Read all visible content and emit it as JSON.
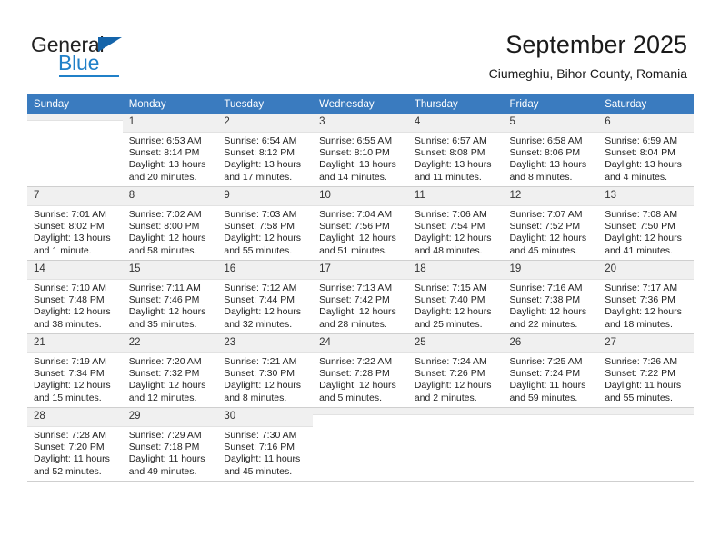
{
  "brand": {
    "name_top": "General",
    "name_bottom": "Blue",
    "accent_color": "#2080c8",
    "triangle_color": "#1464aa"
  },
  "header": {
    "month_title": "September 2025",
    "location": "Ciumeghiu, Bihor County, Romania"
  },
  "calendar": {
    "header_bg": "#3a7bbf",
    "weekdays": [
      "Sunday",
      "Monday",
      "Tuesday",
      "Wednesday",
      "Thursday",
      "Friday",
      "Saturday"
    ],
    "weeks": [
      [
        {
          "day": "",
          "empty": true,
          "sunrise": "",
          "sunset": "",
          "daylight": ""
        },
        {
          "day": "1",
          "sunrise": "Sunrise: 6:53 AM",
          "sunset": "Sunset: 8:14 PM",
          "daylight": "Daylight: 13 hours and 20 minutes."
        },
        {
          "day": "2",
          "sunrise": "Sunrise: 6:54 AM",
          "sunset": "Sunset: 8:12 PM",
          "daylight": "Daylight: 13 hours and 17 minutes."
        },
        {
          "day": "3",
          "sunrise": "Sunrise: 6:55 AM",
          "sunset": "Sunset: 8:10 PM",
          "daylight": "Daylight: 13 hours and 14 minutes."
        },
        {
          "day": "4",
          "sunrise": "Sunrise: 6:57 AM",
          "sunset": "Sunset: 8:08 PM",
          "daylight": "Daylight: 13 hours and 11 minutes."
        },
        {
          "day": "5",
          "sunrise": "Sunrise: 6:58 AM",
          "sunset": "Sunset: 8:06 PM",
          "daylight": "Daylight: 13 hours and 8 minutes."
        },
        {
          "day": "6",
          "sunrise": "Sunrise: 6:59 AM",
          "sunset": "Sunset: 8:04 PM",
          "daylight": "Daylight: 13 hours and 4 minutes."
        }
      ],
      [
        {
          "day": "7",
          "sunrise": "Sunrise: 7:01 AM",
          "sunset": "Sunset: 8:02 PM",
          "daylight": "Daylight: 13 hours and 1 minute."
        },
        {
          "day": "8",
          "sunrise": "Sunrise: 7:02 AM",
          "sunset": "Sunset: 8:00 PM",
          "daylight": "Daylight: 12 hours and 58 minutes."
        },
        {
          "day": "9",
          "sunrise": "Sunrise: 7:03 AM",
          "sunset": "Sunset: 7:58 PM",
          "daylight": "Daylight: 12 hours and 55 minutes."
        },
        {
          "day": "10",
          "sunrise": "Sunrise: 7:04 AM",
          "sunset": "Sunset: 7:56 PM",
          "daylight": "Daylight: 12 hours and 51 minutes."
        },
        {
          "day": "11",
          "sunrise": "Sunrise: 7:06 AM",
          "sunset": "Sunset: 7:54 PM",
          "daylight": "Daylight: 12 hours and 48 minutes."
        },
        {
          "day": "12",
          "sunrise": "Sunrise: 7:07 AM",
          "sunset": "Sunset: 7:52 PM",
          "daylight": "Daylight: 12 hours and 45 minutes."
        },
        {
          "day": "13",
          "sunrise": "Sunrise: 7:08 AM",
          "sunset": "Sunset: 7:50 PM",
          "daylight": "Daylight: 12 hours and 41 minutes."
        }
      ],
      [
        {
          "day": "14",
          "sunrise": "Sunrise: 7:10 AM",
          "sunset": "Sunset: 7:48 PM",
          "daylight": "Daylight: 12 hours and 38 minutes."
        },
        {
          "day": "15",
          "sunrise": "Sunrise: 7:11 AM",
          "sunset": "Sunset: 7:46 PM",
          "daylight": "Daylight: 12 hours and 35 minutes."
        },
        {
          "day": "16",
          "sunrise": "Sunrise: 7:12 AM",
          "sunset": "Sunset: 7:44 PM",
          "daylight": "Daylight: 12 hours and 32 minutes."
        },
        {
          "day": "17",
          "sunrise": "Sunrise: 7:13 AM",
          "sunset": "Sunset: 7:42 PM",
          "daylight": "Daylight: 12 hours and 28 minutes."
        },
        {
          "day": "18",
          "sunrise": "Sunrise: 7:15 AM",
          "sunset": "Sunset: 7:40 PM",
          "daylight": "Daylight: 12 hours and 25 minutes."
        },
        {
          "day": "19",
          "sunrise": "Sunrise: 7:16 AM",
          "sunset": "Sunset: 7:38 PM",
          "daylight": "Daylight: 12 hours and 22 minutes."
        },
        {
          "day": "20",
          "sunrise": "Sunrise: 7:17 AM",
          "sunset": "Sunset: 7:36 PM",
          "daylight": "Daylight: 12 hours and 18 minutes."
        }
      ],
      [
        {
          "day": "21",
          "sunrise": "Sunrise: 7:19 AM",
          "sunset": "Sunset: 7:34 PM",
          "daylight": "Daylight: 12 hours and 15 minutes."
        },
        {
          "day": "22",
          "sunrise": "Sunrise: 7:20 AM",
          "sunset": "Sunset: 7:32 PM",
          "daylight": "Daylight: 12 hours and 12 minutes."
        },
        {
          "day": "23",
          "sunrise": "Sunrise: 7:21 AM",
          "sunset": "Sunset: 7:30 PM",
          "daylight": "Daylight: 12 hours and 8 minutes."
        },
        {
          "day": "24",
          "sunrise": "Sunrise: 7:22 AM",
          "sunset": "Sunset: 7:28 PM",
          "daylight": "Daylight: 12 hours and 5 minutes."
        },
        {
          "day": "25",
          "sunrise": "Sunrise: 7:24 AM",
          "sunset": "Sunset: 7:26 PM",
          "daylight": "Daylight: 12 hours and 2 minutes."
        },
        {
          "day": "26",
          "sunrise": "Sunrise: 7:25 AM",
          "sunset": "Sunset: 7:24 PM",
          "daylight": "Daylight: 11 hours and 59 minutes."
        },
        {
          "day": "27",
          "sunrise": "Sunrise: 7:26 AM",
          "sunset": "Sunset: 7:22 PM",
          "daylight": "Daylight: 11 hours and 55 minutes."
        }
      ],
      [
        {
          "day": "28",
          "sunrise": "Sunrise: 7:28 AM",
          "sunset": "Sunset: 7:20 PM",
          "daylight": "Daylight: 11 hours and 52 minutes."
        },
        {
          "day": "29",
          "sunrise": "Sunrise: 7:29 AM",
          "sunset": "Sunset: 7:18 PM",
          "daylight": "Daylight: 11 hours and 49 minutes."
        },
        {
          "day": "30",
          "sunrise": "Sunrise: 7:30 AM",
          "sunset": "Sunset: 7:16 PM",
          "daylight": "Daylight: 11 hours and 45 minutes."
        },
        {
          "day": "",
          "empty": true,
          "sunrise": "",
          "sunset": "",
          "daylight": ""
        },
        {
          "day": "",
          "empty": true,
          "sunrise": "",
          "sunset": "",
          "daylight": ""
        },
        {
          "day": "",
          "empty": true,
          "sunrise": "",
          "sunset": "",
          "daylight": ""
        },
        {
          "day": "",
          "empty": true,
          "sunrise": "",
          "sunset": "",
          "daylight": ""
        }
      ]
    ]
  }
}
